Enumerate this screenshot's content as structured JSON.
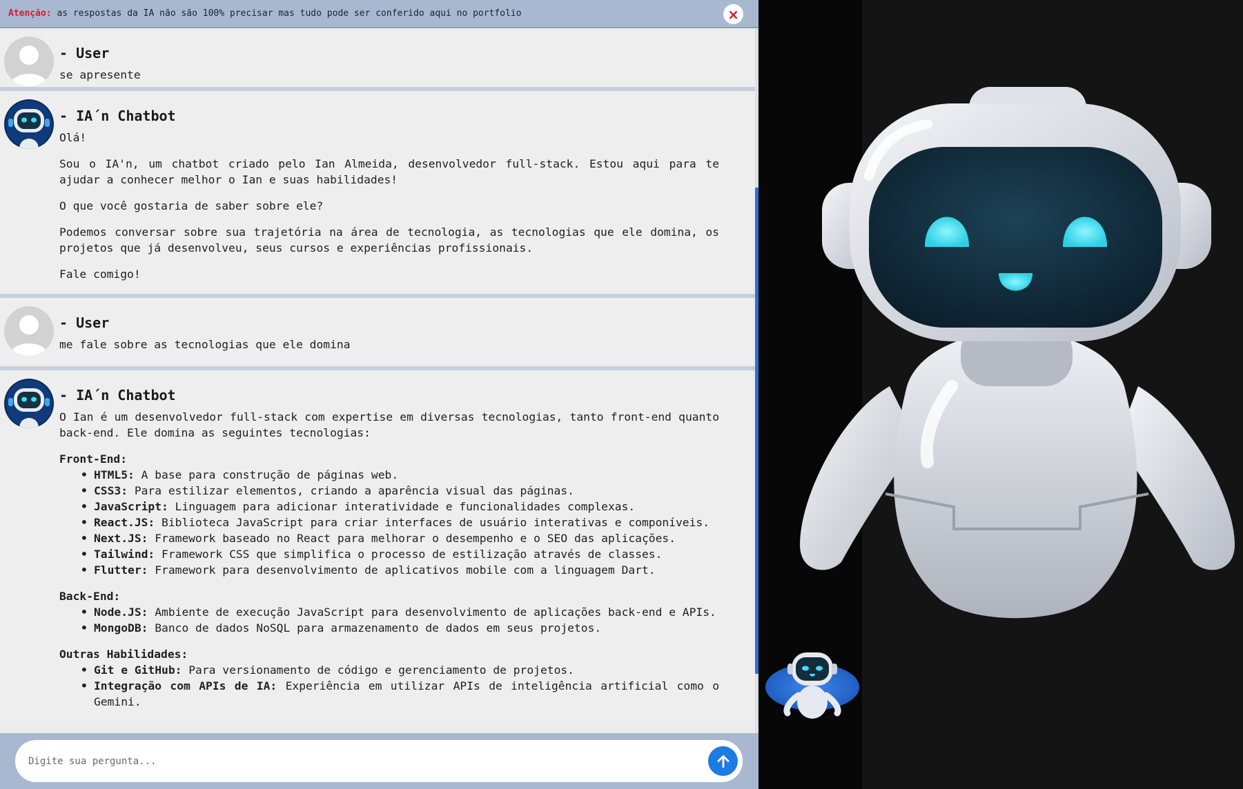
{
  "warning": {
    "label": "Atenção:",
    "text": "as respostas da IA não são 100% precisar mas tudo pode ser conferido aqui no portfolio",
    "close_icon": "×"
  },
  "messages": [
    {
      "sender": "- User",
      "text": "se apresente"
    },
    {
      "sender": "- IA´n Chatbot",
      "paragraphs": [
        "Olá!",
        "Sou o IA'n, um chatbot criado pelo Ian Almeida, desenvolvedor full-stack. Estou aqui para te ajudar a conhecer melhor o Ian e suas habilidades!",
        "O que você gostaria de saber sobre ele?",
        "Podemos conversar sobre sua trajetória na área de tecnologia, as tecnologias que ele domina, os projetos que já desenvolveu, seus cursos e experiências profissionais.",
        "Fale comigo!"
      ]
    },
    {
      "sender": "- User",
      "text": "me fale sobre as tecnologias que ele domina"
    },
    {
      "sender": "- IA´n Chatbot",
      "intro": "O Ian é um desenvolvedor full-stack com expertise em diversas tecnologias, tanto front-end quanto back-end. Ele domina as seguintes tecnologias:",
      "sections": [
        {
          "title": "Front-End:",
          "items": [
            {
              "name": "HTML5:",
              "desc": "A base para construção de páginas web."
            },
            {
              "name": "CSS3:",
              "desc": "Para estilizar elementos, criando a aparência visual das páginas."
            },
            {
              "name": "JavaScript:",
              "desc": "Linguagem para adicionar interatividade e funcionalidades complexas."
            },
            {
              "name": "React.JS:",
              "desc": "Biblioteca JavaScript para criar interfaces de usuário interativas e componíveis."
            },
            {
              "name": "Next.JS:",
              "desc": "Framework baseado no React para melhorar o desempenho e o SEO das aplicações."
            },
            {
              "name": "Tailwind:",
              "desc": "Framework CSS que simplifica o processo de estilização através de classes."
            },
            {
              "name": "Flutter:",
              "desc": "Framework para desenvolvimento de aplicativos mobile com a linguagem Dart."
            }
          ]
        },
        {
          "title": "Back-End:",
          "items": [
            {
              "name": "Node.JS:",
              "desc": "Ambiente de execução JavaScript para desenvolvimento de aplicações back-end e APIs."
            },
            {
              "name": "MongoDB:",
              "desc": "Banco de dados NoSQL para armazenamento de dados em seus projetos."
            }
          ]
        },
        {
          "title": "Outras Habilidades:",
          "items": [
            {
              "name": "Git e GitHub:",
              "desc": "Para versionamento de código e gerenciamento de projetos."
            },
            {
              "name": "Integração com APIs de IA:",
              "desc": "Experiência em utilizar APIs de inteligência artificial como o Gemini."
            }
          ]
        }
      ]
    }
  ],
  "input": {
    "placeholder": "Digite sua pergunta...",
    "value": ""
  },
  "icons": {
    "close": "close-icon",
    "send": "arrow-up-icon",
    "user_avatar": "user-avatar-icon",
    "bot_avatar": "robot-avatar-icon"
  },
  "colors": {
    "warning_bar": "#a9b8d1",
    "warning_label": "#e0142b",
    "send_button": "#1e7be3",
    "scrollbar": "#2f6fd6",
    "robot_eyes": "#3fe0f0"
  }
}
